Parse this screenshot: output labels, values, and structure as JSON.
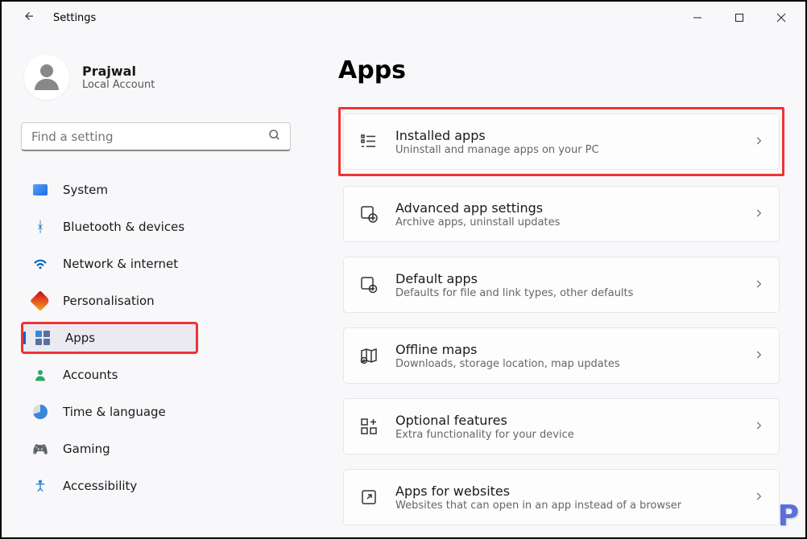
{
  "app": {
    "title": "Settings"
  },
  "profile": {
    "name": "Prajwal",
    "type": "Local Account"
  },
  "search": {
    "placeholder": "Find a setting"
  },
  "sidebar": {
    "items": [
      {
        "label": "System",
        "icon": "system-icon"
      },
      {
        "label": "Bluetooth & devices",
        "icon": "bluetooth-icon"
      },
      {
        "label": "Network & internet",
        "icon": "wifi-icon"
      },
      {
        "label": "Personalisation",
        "icon": "paintbrush-icon"
      },
      {
        "label": "Apps",
        "icon": "apps-icon",
        "active": true
      },
      {
        "label": "Accounts",
        "icon": "person-icon"
      },
      {
        "label": "Time & language",
        "icon": "clock-icon"
      },
      {
        "label": "Gaming",
        "icon": "gamepad-icon"
      },
      {
        "label": "Accessibility",
        "icon": "accessibility-icon"
      }
    ]
  },
  "page": {
    "title": "Apps"
  },
  "cards": [
    {
      "title": "Installed apps",
      "sub": "Uninstall and manage apps on your PC",
      "icon": "list-icon",
      "highlight": true
    },
    {
      "title": "Advanced app settings",
      "sub": "Archive apps, uninstall updates",
      "icon": "gear-app-icon"
    },
    {
      "title": "Default apps",
      "sub": "Defaults for file and link types, other defaults",
      "icon": "default-app-icon"
    },
    {
      "title": "Offline maps",
      "sub": "Downloads, storage location, map updates",
      "icon": "map-icon"
    },
    {
      "title": "Optional features",
      "sub": "Extra functionality for your device",
      "icon": "plus-grid-icon"
    },
    {
      "title": "Apps for websites",
      "sub": "Websites that can open in an app instead of a browser",
      "icon": "external-link-icon"
    }
  ]
}
